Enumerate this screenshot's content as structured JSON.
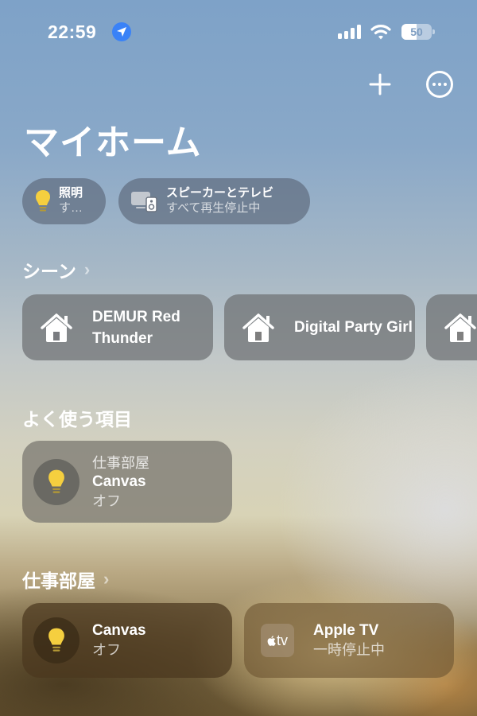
{
  "status_bar": {
    "time": "22:59",
    "location_icon": "location-arrow-icon",
    "signal_icon": "cellular-signal-icon",
    "wifi_icon": "wifi-icon",
    "battery_percent": "50",
    "battery_level": 0.5
  },
  "toolbar": {
    "add_icon": "plus-icon",
    "more_icon": "ellipsis-circle-icon"
  },
  "page": {
    "title": "マイホーム"
  },
  "status_pills": [
    {
      "icon": "lightbulb-icon",
      "title": "照明",
      "subtitle": "す…"
    },
    {
      "icon": "speaker-tv-icon",
      "title": "スピーカーとテレビ",
      "subtitle": "すべて再生停止中"
    }
  ],
  "scenes": {
    "title": "シーン",
    "chevron": "›",
    "items": [
      {
        "icon": "house-icon",
        "label": "DEMUR Red Thunder"
      },
      {
        "icon": "house-icon",
        "label": "Digital Party Girl"
      },
      {
        "icon": "house-icon",
        "label": ""
      }
    ]
  },
  "favorites": {
    "title": "よく使う項目",
    "items": [
      {
        "icon": "lightbulb-icon",
        "room": "仕事部屋",
        "name": "Canvas",
        "state": "オフ"
      }
    ]
  },
  "room": {
    "title": "仕事部屋",
    "chevron": "›",
    "items": [
      {
        "icon": "lightbulb-icon",
        "name": "Canvas",
        "state": "オフ"
      },
      {
        "icon": "apple-tv-icon",
        "icon_text": "tv",
        "name": "Apple TV",
        "state": "一時停止中"
      }
    ]
  },
  "colors": {
    "bulb": "#f5cf3f",
    "location_badge": "#3a82f7"
  }
}
